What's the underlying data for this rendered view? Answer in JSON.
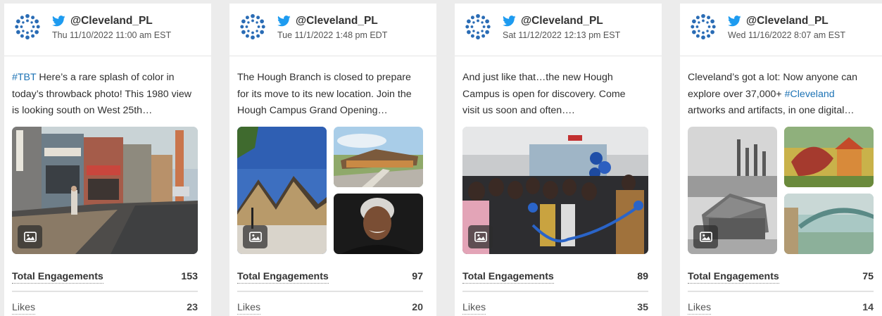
{
  "colors": {
    "twitter_blue": "#1d9bf0",
    "logo_blue": "#2a6cb5",
    "hashtag": "#1d73b5"
  },
  "icons": {
    "platform": "twitter-bird-icon",
    "media": "image-icon",
    "avatar": "library-logo-icon"
  },
  "metric_labels": {
    "total": "Total Engagements",
    "likes": "Likes"
  },
  "posts": [
    {
      "handle": "@Cleveland_PL",
      "time": "Thu 11/10/2022 11:00 am EST",
      "text_tag": "#TBT",
      "text": " Here’s a rare splash of color in today’s throwback photo! This 1980 view is looking south on West 25th…",
      "total_engagements": "153",
      "likes": "23"
    },
    {
      "handle": "@Cleveland_PL",
      "time": "Tue 11/1/2022 1:48 pm EDT",
      "text": "The Hough Branch is closed to prepare for its move to its new location. Join the Hough Campus Grand Opening…",
      "total_engagements": "97",
      "likes": "20"
    },
    {
      "handle": "@Cleveland_PL",
      "time": "Sat 11/12/2022 12:13 pm EST",
      "text": "And just like that…the new Hough Campus is open for discovery. Come visit us soon and often….",
      "total_engagements": "89",
      "likes": "35"
    },
    {
      "handle": "@Cleveland_PL",
      "time": "Wed 11/16/2022 8:07 am EST",
      "text_pre": "Cleveland’s got a lot: Now anyone can explore over 37,000+ ",
      "text_tag": "#Cleveland",
      "text_post": " artworks and artifacts, in one digital…",
      "total_engagements": "75",
      "likes": "14"
    }
  ]
}
